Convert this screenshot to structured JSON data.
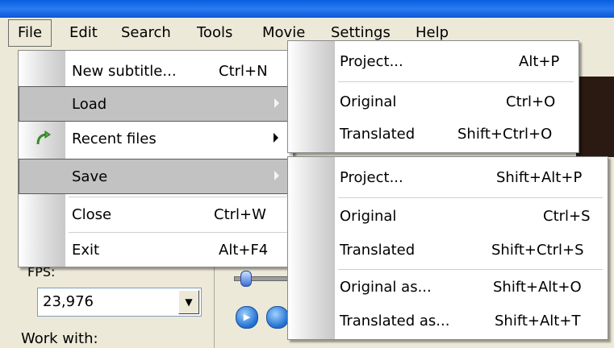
{
  "menubar": {
    "items": [
      "File",
      "Edit",
      "Search",
      "Tools",
      "Movie",
      "Settings",
      "Help"
    ]
  },
  "file_menu": {
    "items": [
      {
        "label": "New subtitle...",
        "shortcut": "Ctrl+N"
      },
      {
        "label": "Load",
        "shortcut": ""
      },
      {
        "label": "Recent files",
        "shortcut": ""
      },
      {
        "label": "Save",
        "shortcut": ""
      },
      {
        "label": "Close",
        "shortcut": "Ctrl+W"
      },
      {
        "label": "Exit",
        "shortcut": "Alt+F4"
      }
    ]
  },
  "load_submenu": {
    "items": [
      {
        "label": "Project...",
        "shortcut": "Alt+P"
      },
      {
        "label": "Original",
        "shortcut": "Ctrl+O"
      },
      {
        "label": "Translated",
        "shortcut": "Shift+Ctrl+O"
      }
    ]
  },
  "save_submenu": {
    "items": [
      {
        "label": "Project...",
        "shortcut": "Shift+Alt+P"
      },
      {
        "label": "Original",
        "shortcut": "Ctrl+S"
      },
      {
        "label": "Translated",
        "shortcut": "Shift+Ctrl+S"
      },
      {
        "label": "Original as...",
        "shortcut": "Shift+Alt+O"
      },
      {
        "label": "Translated as...",
        "shortcut": "Shift+Alt+T"
      }
    ]
  },
  "background": {
    "fps_value": "23,976",
    "work_with_label": "Work with:"
  },
  "icons": {
    "recent_files": "recent-arrow-icon"
  },
  "colors": {
    "titlebar": "#0a5fe0",
    "selection": "#c2c2c2",
    "dark_panel": "#2b1a12"
  }
}
